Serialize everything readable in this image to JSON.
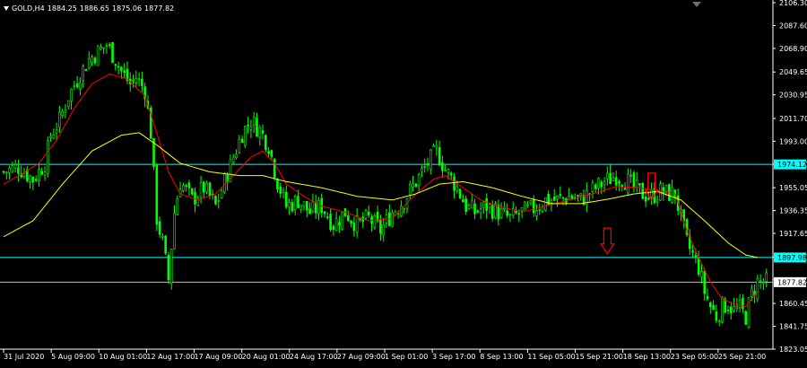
{
  "symbol": {
    "name": "GOLD,H4",
    "open": "1884.25",
    "high": "1886.65",
    "low": "1875.06",
    "close": "1877.82"
  },
  "price_axis": {
    "ticks": [
      "2106.30",
      "2087.60",
      "2068.90",
      "2049.65",
      "2030.95",
      "2011.70",
      "1993.00",
      "1974.30",
      "1955.05",
      "1936.35",
      "1917.65",
      "1898.40",
      "1879.70",
      "1860.45",
      "1841.75",
      "1823.05"
    ],
    "labels": [
      {
        "text": "1974.12",
        "value": 1974.12,
        "bg": "#00ffff",
        "color": "#000000"
      },
      {
        "text": "1897.98",
        "value": 1897.98,
        "bg": "#00ffff",
        "color": "#000000"
      },
      {
        "text": "1877.82",
        "value": 1877.82,
        "bg": "#ffffff",
        "color": "#000000"
      }
    ]
  },
  "time_axis": {
    "labels": [
      "31 Jul 2020",
      "5 Aug 09:00",
      "10 Aug 01:00",
      "12 Aug 17:00",
      "17 Aug 09:00",
      "20 Aug 01:00",
      "24 Aug 17:00",
      "27 Aug 09:00",
      "1 Sep 01:00",
      "3 Sep 17:00",
      "8 Sep 13:00",
      "11 Sep 05:00",
      "15 Sep 21:00",
      "18 Sep 13:00",
      "23 Sep 05:00",
      "25 Sep 21:00"
    ]
  },
  "colors": {
    "background": "#000000",
    "bull": "#00ff00",
    "bear": "#00ff00",
    "ma_fast": "#ff0000",
    "ma_slow": "#ffff00",
    "level_line": "#00ffff",
    "price_line": "#c0c0c0",
    "axis": "#ffffff",
    "arrow": "#ff0000"
  },
  "chart_data": {
    "type": "candlestick",
    "series": [
      {
        "name": "close",
        "path": [
          [
            0,
            1968
          ],
          [
            5,
            1972
          ],
          [
            10,
            1962
          ],
          [
            14,
            1975
          ],
          [
            16,
            1998
          ],
          [
            19,
            2010
          ],
          [
            22,
            2030
          ],
          [
            26,
            2048
          ],
          [
            29,
            2060
          ],
          [
            32,
            2066
          ],
          [
            35,
            2072
          ],
          [
            38,
            2060
          ],
          [
            40,
            2050
          ],
          [
            43,
            2040
          ],
          [
            45,
            2045
          ],
          [
            48,
            2035
          ],
          [
            50,
            2000
          ],
          [
            52,
            1930
          ],
          [
            54,
            1910
          ],
          [
            56,
            1880
          ],
          [
            58,
            1935
          ],
          [
            60,
            1960
          ],
          [
            64,
            1945
          ],
          [
            68,
            1955
          ],
          [
            72,
            1940
          ],
          [
            75,
            1960
          ],
          [
            78,
            1980
          ],
          [
            81,
            2000
          ],
          [
            84,
            2010
          ],
          [
            87,
            2002
          ],
          [
            90,
            1990
          ],
          [
            93,
            1960
          ],
          [
            96,
            1940
          ],
          [
            100,
            1945
          ],
          [
            104,
            1935
          ],
          [
            108,
            1940
          ],
          [
            112,
            1925
          ],
          [
            116,
            1935
          ],
          [
            120,
            1925
          ],
          [
            124,
            1930
          ],
          [
            128,
            1920
          ],
          [
            132,
            1935
          ],
          [
            136,
            1945
          ],
          [
            140,
            1960
          ],
          [
            144,
            1975
          ],
          [
            147,
            1985
          ],
          [
            150,
            1970
          ],
          [
            154,
            1955
          ],
          [
            157,
            1940
          ],
          [
            160,
            1935
          ],
          [
            164,
            1940
          ],
          [
            168,
            1935
          ],
          [
            172,
            1930
          ],
          [
            176,
            1935
          ],
          [
            180,
            1938
          ],
          [
            184,
            1945
          ],
          [
            188,
            1945
          ],
          [
            192,
            1948
          ],
          [
            196,
            1945
          ],
          [
            200,
            1953
          ],
          [
            204,
            1960
          ],
          [
            208,
            1965
          ],
          [
            212,
            1960
          ],
          [
            214,
            1955
          ],
          [
            217,
            1950
          ],
          [
            220,
            1948
          ],
          [
            223,
            1952
          ],
          [
            226,
            1950
          ],
          [
            228,
            1950
          ],
          [
            230,
            1930
          ],
          [
            232,
            1910
          ],
          [
            234,
            1900
          ],
          [
            236,
            1890
          ],
          [
            238,
            1870
          ],
          [
            240,
            1858
          ],
          [
            242,
            1850
          ],
          [
            244,
            1858
          ],
          [
            246,
            1860
          ],
          [
            248,
            1855
          ],
          [
            250,
            1856
          ],
          [
            252,
            1850
          ],
          [
            254,
            1868
          ],
          [
            256,
            1878
          ]
        ]
      },
      {
        "name": "MA fast",
        "path": [
          [
            0,
            1958
          ],
          [
            6,
            1966
          ],
          [
            12,
            1975
          ],
          [
            18,
            1994
          ],
          [
            24,
            2020
          ],
          [
            30,
            2040
          ],
          [
            36,
            2048
          ],
          [
            42,
            2044
          ],
          [
            48,
            2030
          ],
          [
            52,
            2000
          ],
          [
            56,
            1968
          ],
          [
            60,
            1950
          ],
          [
            66,
            1945
          ],
          [
            72,
            1950
          ],
          [
            78,
            1965
          ],
          [
            84,
            1980
          ],
          [
            88,
            1985
          ],
          [
            92,
            1975
          ],
          [
            96,
            1958
          ],
          [
            102,
            1948
          ],
          [
            108,
            1940
          ],
          [
            116,
            1935
          ],
          [
            124,
            1928
          ],
          [
            132,
            1930
          ],
          [
            140,
            1950
          ],
          [
            146,
            1962
          ],
          [
            150,
            1965
          ],
          [
            156,
            1955
          ],
          [
            162,
            1945
          ],
          [
            168,
            1940
          ],
          [
            176,
            1935
          ],
          [
            184,
            1940
          ],
          [
            192,
            1945
          ],
          [
            200,
            1950
          ],
          [
            208,
            1956
          ],
          [
            216,
            1955
          ],
          [
            224,
            1952
          ],
          [
            228,
            1950
          ],
          [
            232,
            1920
          ],
          [
            236,
            1898
          ],
          [
            240,
            1878
          ],
          [
            244,
            1864
          ],
          [
            248,
            1860
          ],
          [
            252,
            1858
          ],
          [
            256,
            1870
          ]
        ]
      },
      {
        "name": "MA slow",
        "path": [
          [
            0,
            1915
          ],
          [
            10,
            1928
          ],
          [
            20,
            1958
          ],
          [
            30,
            1985
          ],
          [
            40,
            1998
          ],
          [
            46,
            2000
          ],
          [
            52,
            1990
          ],
          [
            60,
            1975
          ],
          [
            70,
            1968
          ],
          [
            80,
            1965
          ],
          [
            88,
            1965
          ],
          [
            96,
            1960
          ],
          [
            108,
            1955
          ],
          [
            120,
            1948
          ],
          [
            132,
            1945
          ],
          [
            140,
            1950
          ],
          [
            148,
            1958
          ],
          [
            156,
            1960
          ],
          [
            166,
            1955
          ],
          [
            176,
            1948
          ],
          [
            186,
            1942
          ],
          [
            196,
            1942
          ],
          [
            206,
            1946
          ],
          [
            214,
            1950
          ],
          [
            222,
            1952
          ],
          [
            230,
            1945
          ],
          [
            238,
            1928
          ],
          [
            246,
            1910
          ],
          [
            252,
            1900
          ],
          [
            256,
            1898
          ]
        ]
      }
    ],
    "levels": [
      1974.12,
      1897.98
    ],
    "last_price": 1877.82,
    "ylim": [
      1823.05,
      2106.3
    ],
    "arrows": [
      {
        "x": 220,
        "y_top": 1967,
        "y_bottom": 1945
      },
      {
        "x": 205,
        "y_top": 1922,
        "y_bottom": 1901
      }
    ]
  }
}
